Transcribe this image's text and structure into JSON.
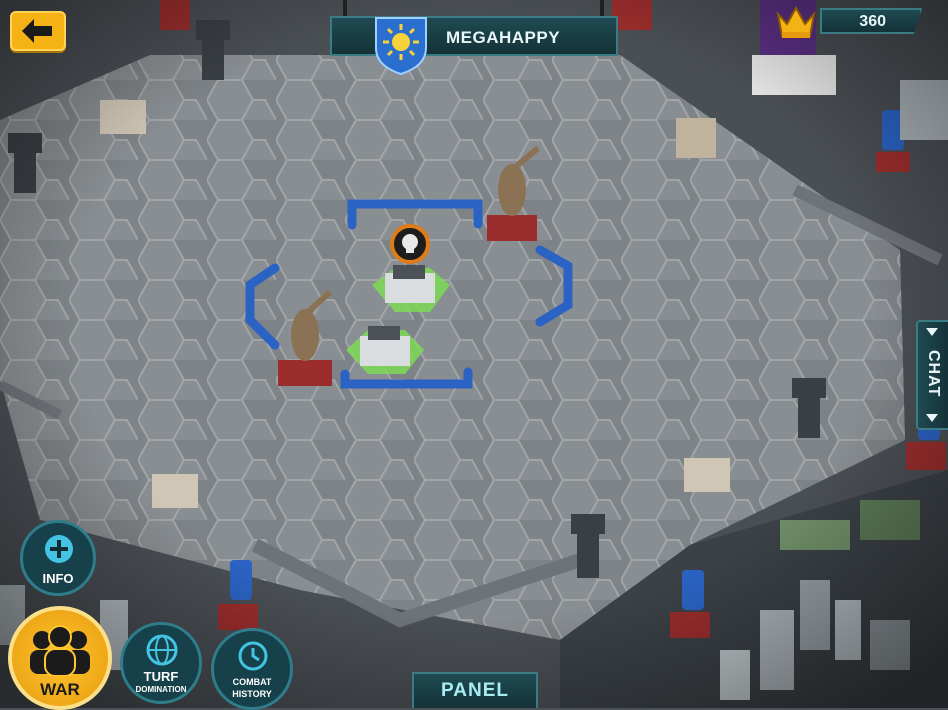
{
  "header": {
    "back_icon": "arrow-left-icon",
    "player_name": "MEGAHAPPY",
    "emblem_icon": "sun-emblem-icon",
    "currency_icon": "crown-icon",
    "currency_value": "360"
  },
  "side": {
    "chat_label": "CHAT"
  },
  "buttons": {
    "info_label": "INFO",
    "war_label": "WAR",
    "turf_label_1": "TURF",
    "turf_label_2": "DOMINATION",
    "combat_label_1": "COMBAT",
    "combat_label_2": "HISTORY",
    "panel_label": "PANEL"
  },
  "colors": {
    "accent_teal": "#2f7c8a",
    "gold": "#f4b214",
    "team_blue": "#2b63c4",
    "zone_green": "#7ed957",
    "skull_badge": "#e07b16"
  }
}
